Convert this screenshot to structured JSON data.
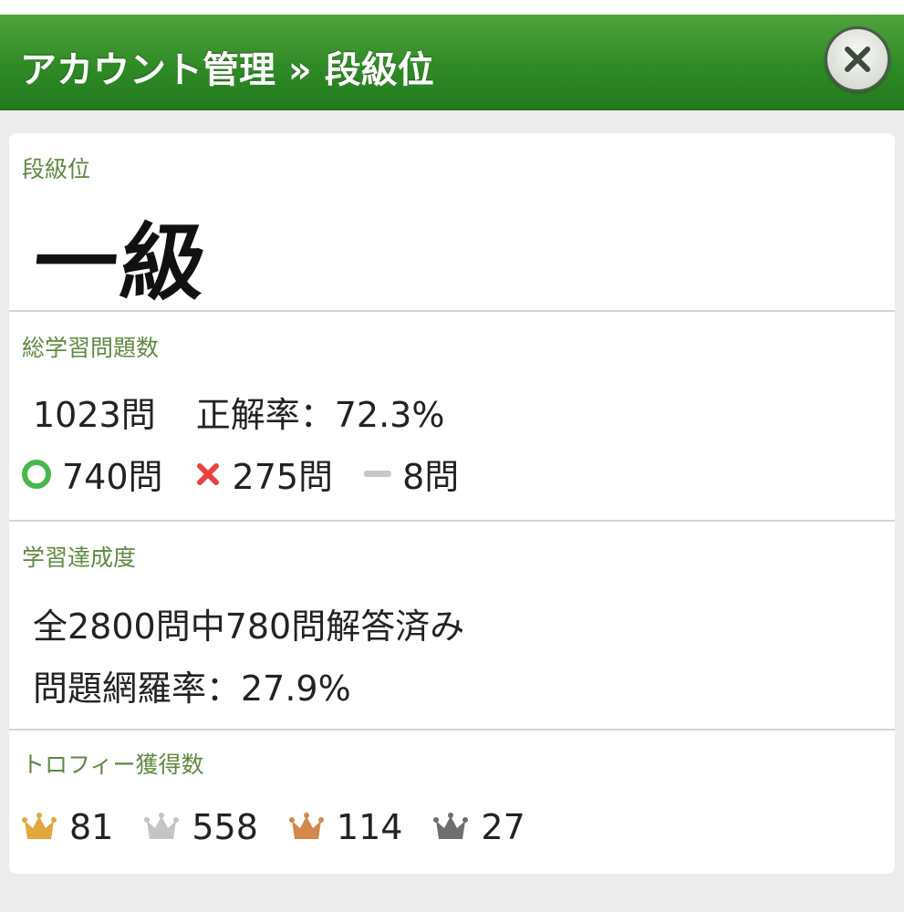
{
  "header": {
    "title": "アカウント管理 » 段級位",
    "close_icon": "close-x-icon"
  },
  "rank": {
    "label": "段級位",
    "value": "一級"
  },
  "total": {
    "label": "総学習問題数",
    "count": "1023問",
    "accuracy": "正解率：72.3%",
    "correct": "740問",
    "incorrect": "275問",
    "skipped": "8問",
    "colors": {
      "correct": "#49b84a",
      "incorrect": "#e8423f",
      "skipped": "#c7c7c7"
    }
  },
  "progress": {
    "label": "学習達成度",
    "answered": "全2800問中780問解答済み",
    "coverage": "問題網羅率：27.9%"
  },
  "trophies": {
    "label": "トロフィー獲得数",
    "items": [
      {
        "name": "gold",
        "count": "81",
        "color": "#e3a83c"
      },
      {
        "name": "silver",
        "count": "558",
        "color": "#c4c4c4"
      },
      {
        "name": "bronze",
        "count": "114",
        "color": "#d3894b"
      },
      {
        "name": "dark",
        "count": "27",
        "color": "#6e6e6e"
      }
    ]
  },
  "colors": {
    "header_green": "#3a9a2e",
    "label_green": "#5c8a3f",
    "background": "#ececec"
  }
}
